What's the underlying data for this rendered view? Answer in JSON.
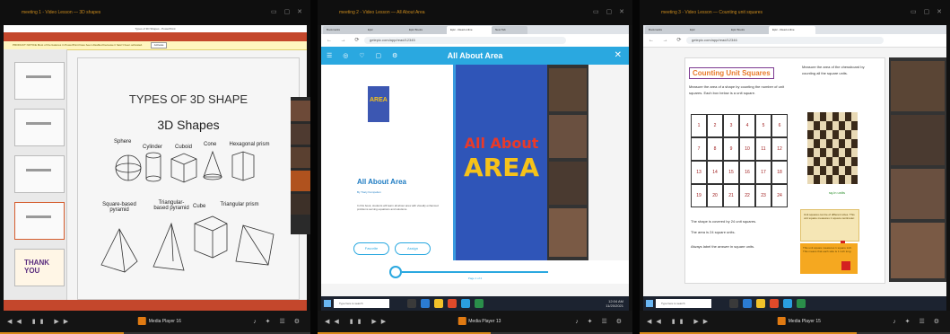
{
  "panels": [
    {
      "title": "meeting 1 - Video Lesson — 3D shapes",
      "ppt": {
        "window_title": "Types of 3D Shapes - PowerPoint",
        "menu": [
          "FILE",
          "HOME",
          "INSERT",
          "DESIGN",
          "TRANSITIONS",
          "ANIMATIONS",
          "SLIDE SHOW",
          "REVIEW",
          "VIEW"
        ],
        "warning": "PRODUCT NOTICE  Most of the features in PowerPoint have been disabled because it hasn't been activated.",
        "warning_button": "Activate",
        "thumb_last": "THANK YOU",
        "slide_title": "TYPES OF 3D SHAPE",
        "slide_subtitle": "3D Shapes",
        "shapes": [
          "Sphere",
          "Cylinder",
          "Cuboid",
          "Cone",
          "Hexagonal prism",
          "Square-based pyramid",
          "Triangular-based pyramid",
          "Cube",
          "Triangular prism"
        ]
      },
      "player": {
        "app": "Media Player 16"
      }
    },
    {
      "title": "meeting 2 - Video Lesson — All About Area",
      "browser": {
        "tabs": [
          "Bookmarks",
          "Epic",
          "Epic Books",
          "Epic - Read online",
          "New Tab"
        ],
        "url": "getepic.com/app/read/12345",
        "header_title": "All About Area",
        "book_title": "All About Area",
        "book_author": "By Tracy Kompelien",
        "book_desc": "In this book, students will learn all about area with visually enhanced problems serving equations and solutions.",
        "cover_small": "AREA",
        "cover_big_1": "All About",
        "cover_big_2": "AREA",
        "favorite": "Favorite",
        "assign": "Assign",
        "page_indicator": "Page 1 of 2",
        "search_placeholder": "Type here to search",
        "clock_time": "12:04 AM",
        "clock_date": "11/20/2021"
      },
      "player": {
        "app": "Media Player 13"
      }
    },
    {
      "title": "meeting 3 - Video Lesson — Counting unit squares",
      "worksheet": {
        "title": "Counting Unit Squares",
        "intro": "Measure the area of a shape by counting the number of unit squares. Each box below is a unit square.",
        "right_intro": "Measure the area of the chessboard by counting all the square units.",
        "grid": [
          [
            "1",
            "2",
            "3",
            "4",
            "5",
            "6"
          ],
          [
            "7",
            "8",
            "9",
            "10",
            "11",
            "12"
          ],
          [
            "13",
            "14",
            "15",
            "16",
            "17",
            "18"
          ],
          [
            "19",
            "20",
            "21",
            "22",
            "23",
            "24"
          ]
        ],
        "square_units": "sq.in units",
        "bottom_1": "The shape is covered by 24 unit squares.",
        "bottom_2": "The area is 24 square units.",
        "bottom_3": "Always label the answer in square units.",
        "box1": "Unit squares can be of different sizes. This unit square measures 1 square centimeter.",
        "box2": "This unit square measures 1 square inch. This means that each side is 1 inch long."
      },
      "browser": {
        "url": "getepic.com/app/read/12346",
        "search_placeholder": "Type here to search"
      },
      "player": {
        "app": "Media Player 15"
      }
    }
  ],
  "colors": {
    "ppt_red": "#c4472c",
    "epic_blue": "#2aa8e0",
    "player_orange": "#e07a12"
  }
}
